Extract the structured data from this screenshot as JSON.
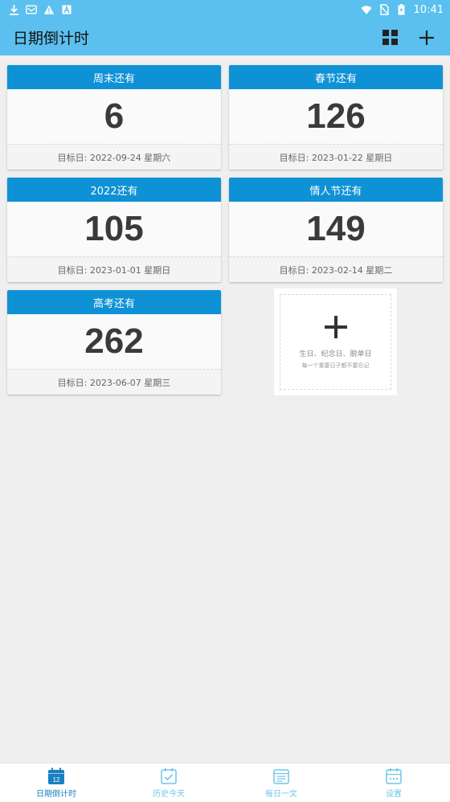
{
  "status_bar": {
    "time": "10:41",
    "icons": [
      "download-icon",
      "mail-icon",
      "warning-icon",
      "a-icon",
      "wifi-icon",
      "no-sim-icon",
      "battery-icon"
    ]
  },
  "app_bar": {
    "title": "日期倒计时",
    "actions": [
      "grid-view-icon",
      "add-icon"
    ]
  },
  "cards": [
    {
      "title": "周末还有",
      "days": "6",
      "target": "目标日: 2022-09-24 星期六"
    },
    {
      "title": "春节还有",
      "days": "126",
      "target": "目标日: 2023-01-22 星期日"
    },
    {
      "title": "2022还有",
      "days": "105",
      "target": "目标日: 2023-01-01 星期日"
    },
    {
      "title": "情人节还有",
      "days": "149",
      "target": "目标日: 2023-02-14 星期二"
    },
    {
      "title": "高考还有",
      "days": "262",
      "target": "目标日: 2023-06-07 星期三"
    }
  ],
  "add_card": {
    "line1": "生日、纪念日、脱单日",
    "line2": "每一个重要日子都不要忘记"
  },
  "bottom_nav": {
    "items": [
      {
        "label": "日期倒计时",
        "icon": "calendar-12-icon",
        "active": true
      },
      {
        "label": "历史今天",
        "icon": "calendar-check-icon",
        "active": false
      },
      {
        "label": "每日一文",
        "icon": "document-icon",
        "active": false
      },
      {
        "label": "设置",
        "icon": "calendar-dots-icon",
        "active": false
      }
    ]
  },
  "colors": {
    "app_bar": "#5bc0ef",
    "card_header": "#0f91d6",
    "nav_active": "#1a7fc4",
    "nav_inactive": "#6dc5ec",
    "background": "#efefef"
  }
}
